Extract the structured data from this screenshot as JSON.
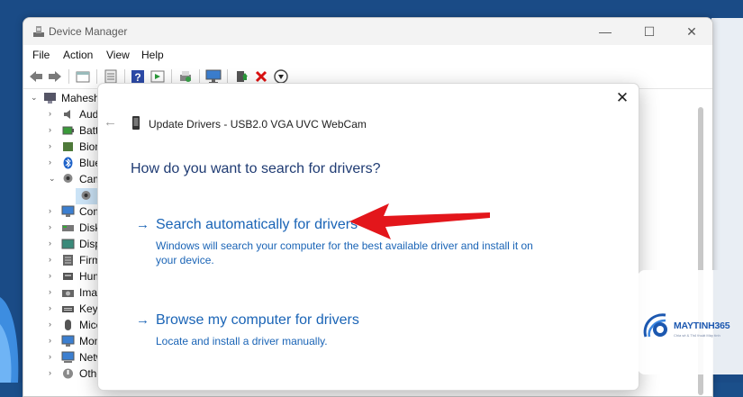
{
  "window": {
    "title": "Device Manager",
    "controls": {
      "minimize": "—",
      "maximize": "☐",
      "close": "✕"
    }
  },
  "menu": [
    "File",
    "Action",
    "View",
    "Help"
  ],
  "toolbar_icons": [
    "back-arrow-icon",
    "forward-arrow-icon",
    "properties-icon",
    "tree-view-icon",
    "help-icon",
    "action-icon",
    "print-icon",
    "scan-hardware-icon",
    "update-driver-icon",
    "uninstall-icon",
    "download-icon"
  ],
  "tree": {
    "root": "Mahesh",
    "items": [
      {
        "label": "Aud",
        "expanded": false
      },
      {
        "label": "Batt",
        "expanded": false
      },
      {
        "label": "Biom",
        "expanded": false
      },
      {
        "label": "Blue",
        "expanded": false
      },
      {
        "label": "Cam",
        "expanded": true
      },
      {
        "label": "Com",
        "expanded": false
      },
      {
        "label": "Disk",
        "expanded": false
      },
      {
        "label": "Disp",
        "expanded": false
      },
      {
        "label": "Firm",
        "expanded": false
      },
      {
        "label": "Hum",
        "expanded": false
      },
      {
        "label": "Imag",
        "expanded": false
      },
      {
        "label": "Keyb",
        "expanded": false
      },
      {
        "label": "Mice",
        "expanded": false
      },
      {
        "label": "Mon",
        "expanded": false
      },
      {
        "label": "Netw",
        "expanded": false
      },
      {
        "label": "Othe",
        "expanded": false
      }
    ]
  },
  "dialog": {
    "title": "Update Drivers - USB2.0 VGA UVC WebCam",
    "heading": "How do you want to search for drivers?",
    "close_symbol": "✕",
    "back_symbol": "←",
    "options": [
      {
        "arrow": "→",
        "title": "Search automatically for drivers",
        "description": "Windows will search your computer for the best available driver and install it on your device."
      },
      {
        "arrow": "→",
        "title": "Browse my computer for drivers",
        "description": "Locate and install a driver manually."
      }
    ]
  },
  "watermark": {
    "brand": "MAYTINH365",
    "tagline": "Chia sẻ & Thủ thuật Máy tính"
  },
  "colors": {
    "link": "#1a64b6",
    "heading": "#1f3b73",
    "annotation_arrow": "#e3161b",
    "brand": "#1c58b0"
  }
}
